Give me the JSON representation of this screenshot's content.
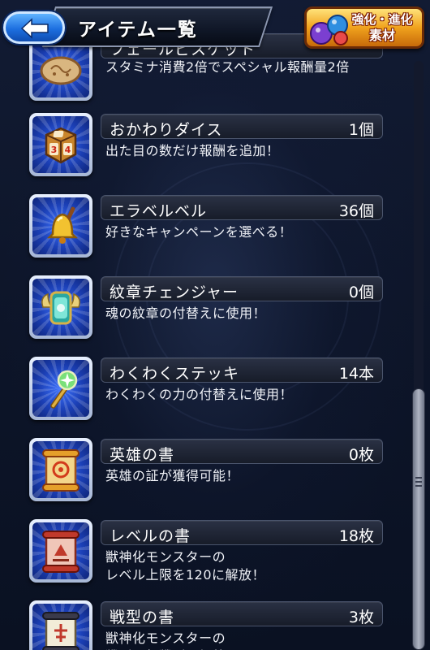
{
  "header": {
    "title": "アイテム一覧",
    "power_button": {
      "line1": "強化・進化",
      "line2": "素材"
    }
  },
  "items": [
    {
      "name": "フェールビスケット",
      "qty": "",
      "desc": "スタミナ消費2倍でスペシャル報酬量2倍",
      "icon": "biscuit-icon"
    },
    {
      "name": "おかわりダイス",
      "qty": "1個",
      "desc": "出た目の数だけ報酬を追加！",
      "icon": "dice-icon"
    },
    {
      "name": "エラベルベル",
      "qty": "36個",
      "desc": "好きなキャンペーンを選べる！",
      "icon": "bell-icon"
    },
    {
      "name": "紋章チェンジャー",
      "qty": "0個",
      "desc": "魂の紋章の付替えに使用！",
      "icon": "emblem-changer-icon"
    },
    {
      "name": "わくわくステッキ",
      "qty": "14本",
      "desc": "わくわくの力の付替えに使用！",
      "icon": "wand-icon"
    },
    {
      "name": "英雄の書",
      "qty": "0枚",
      "desc": "英雄の証が獲得可能！",
      "icon": "hero-scroll-icon"
    },
    {
      "name": "レベルの書",
      "qty": "18枚",
      "desc": "獣神化モンスターの\nレベル上限を120に解放！",
      "icon": "level-scroll-icon"
    },
    {
      "name": "戦型の書",
      "qty": "3枚",
      "desc": "獣神化モンスターの\n戦型を超戦型に解放！",
      "icon": "battle-type-scroll-icon"
    }
  ],
  "colors": {
    "accent_blue": "#1d6fe0",
    "accent_orange": "#f0a21d",
    "panel": "#171c29",
    "background": "#0d1529"
  }
}
